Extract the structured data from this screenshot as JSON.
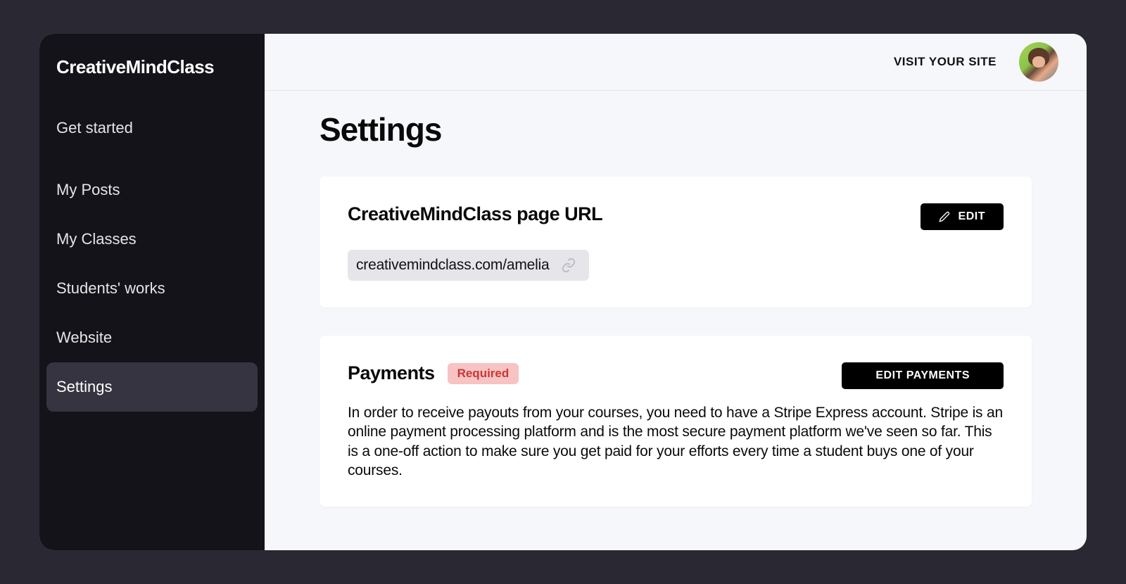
{
  "sidebar": {
    "brand": "CreativeMindClass",
    "items": [
      {
        "label": "Get started"
      },
      {
        "label": "My Posts"
      },
      {
        "label": "My Classes"
      },
      {
        "label": "Students' works"
      },
      {
        "label": "Website"
      },
      {
        "label": "Settings"
      }
    ],
    "active_index": 5
  },
  "topbar": {
    "visit_site_label": "VISIT YOUR SITE"
  },
  "page_title": "Settings",
  "url_card": {
    "title": "CreativeMindClass page URL",
    "edit_label": "EDIT",
    "url_value": "creativemindclass.com/amelia"
  },
  "payments_card": {
    "title": "Payments",
    "badge_label": "Required",
    "edit_label": "EDIT PAYMENTS",
    "description": "In order to receive payouts from your courses, you need to have a Stripe Express account. Stripe is an online payment processing platform and is the most secure payment platform we've seen so far. This is a one-off action to make sure you get paid for your efforts every time a student buys one of your courses."
  }
}
